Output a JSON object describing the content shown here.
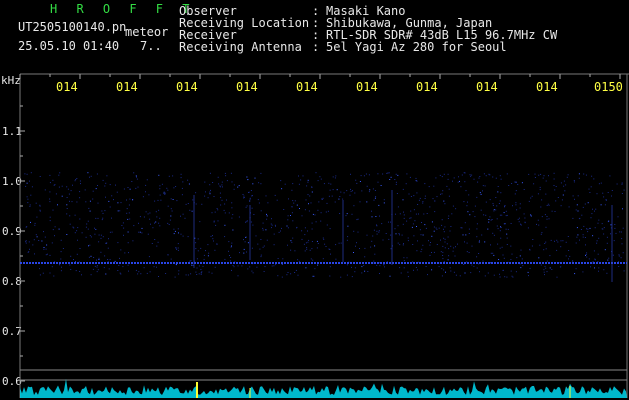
{
  "header": {
    "app_name": "H R O F F T",
    "filename": "UT2505100140.pn",
    "tag": "meteor",
    "datetime": "25.05.10 01:40",
    "count": "7..",
    "fields": [
      {
        "label": "Observer",
        "value": "Masaki Kano"
      },
      {
        "label": "Receiving Location",
        "value": "Shibukawa, Gunma, Japan"
      },
      {
        "label": "Receiver",
        "value": "RTL-SDR SDR# 43dB L15 96.7MHz CW"
      },
      {
        "label": "Receiving Antenna",
        "value": "5el Yagi Az 280 for Seoul"
      }
    ],
    "separator": ":"
  },
  "axis": {
    "unit": "kHz",
    "time_ticks": [
      "014",
      "014",
      "014",
      "014",
      "014",
      "014",
      "014",
      "014",
      "014",
      "0150"
    ],
    "freq_ticks": [
      "1.1",
      "1.0",
      "0.9",
      "0.8",
      "0.7",
      "0.6"
    ]
  },
  "colors": {
    "background": "#000000",
    "text": "#e8e8e8",
    "title": "#33dd44",
    "time_ticks": "#ffff44",
    "signal": "#3355ff",
    "peak": "#ffff33",
    "spectrum": "#00e5ff"
  }
}
